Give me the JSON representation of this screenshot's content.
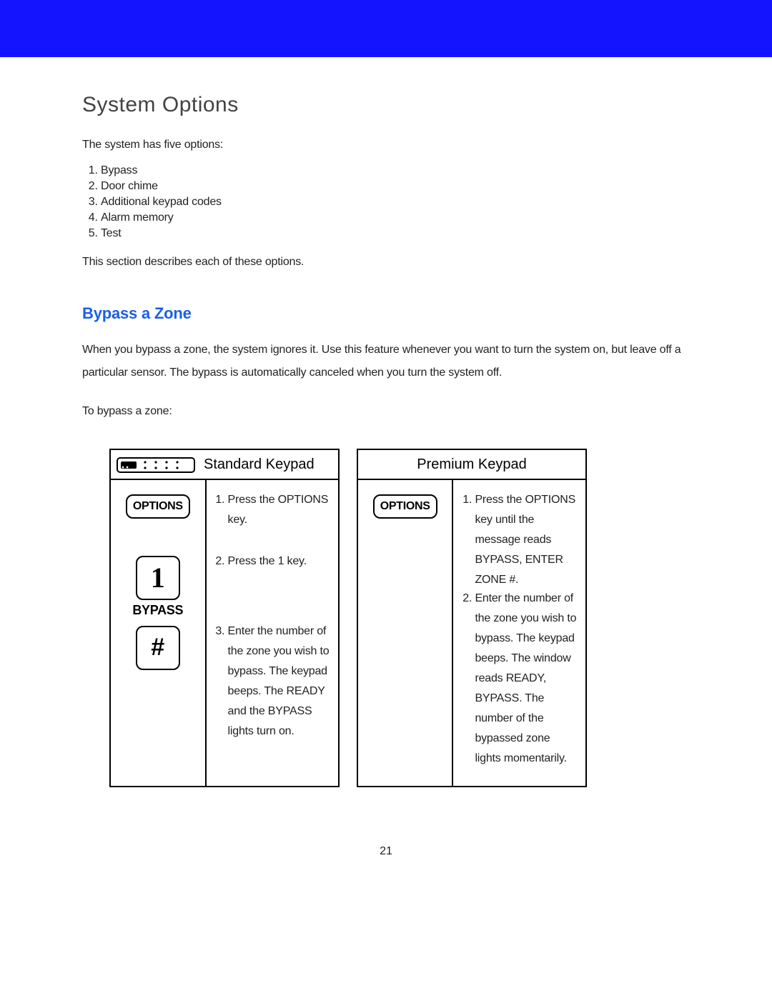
{
  "heading": "System Options",
  "intro": "The system has five options:",
  "options": [
    "Bypass",
    "Door chime",
    "Additional keypad codes",
    "Alarm memory",
    "Test"
  ],
  "section_desc": "This section describes each of these options.",
  "subheading": "Bypass a Zone",
  "bypass_para": "When you bypass a zone, the system ignores it. Use this feature whenever you want to turn the system on, but leave off a particular sensor. The bypass is automatically canceled when you turn the system off.",
  "to_bypass": "To bypass a zone:",
  "standard": {
    "header": "Standard Keypad",
    "options_key": "OPTIONS",
    "key_one": "1",
    "bypass_label": "BYPASS",
    "hash_key": "#",
    "steps": {
      "s1": "Press the OPTIONS key.",
      "s2": "Press the 1 key.",
      "s3": "Enter the number of the zone you wish to bypass. The keypad beeps. The  READY and the BYPASS lights turn on."
    }
  },
  "premium": {
    "header": "Premium Keypad",
    "options_key": "OPTIONS",
    "steps": {
      "s1": "Press the OPTIONS key until the message reads BYPASS, ENTER ZONE #.",
      "s2": "Enter the number of the zone you wish to bypass. The keypad beeps. The  win­dow reads READY, BYPASS. The number of the bypassed zone lights  momentarily."
    }
  },
  "page_number": "21"
}
